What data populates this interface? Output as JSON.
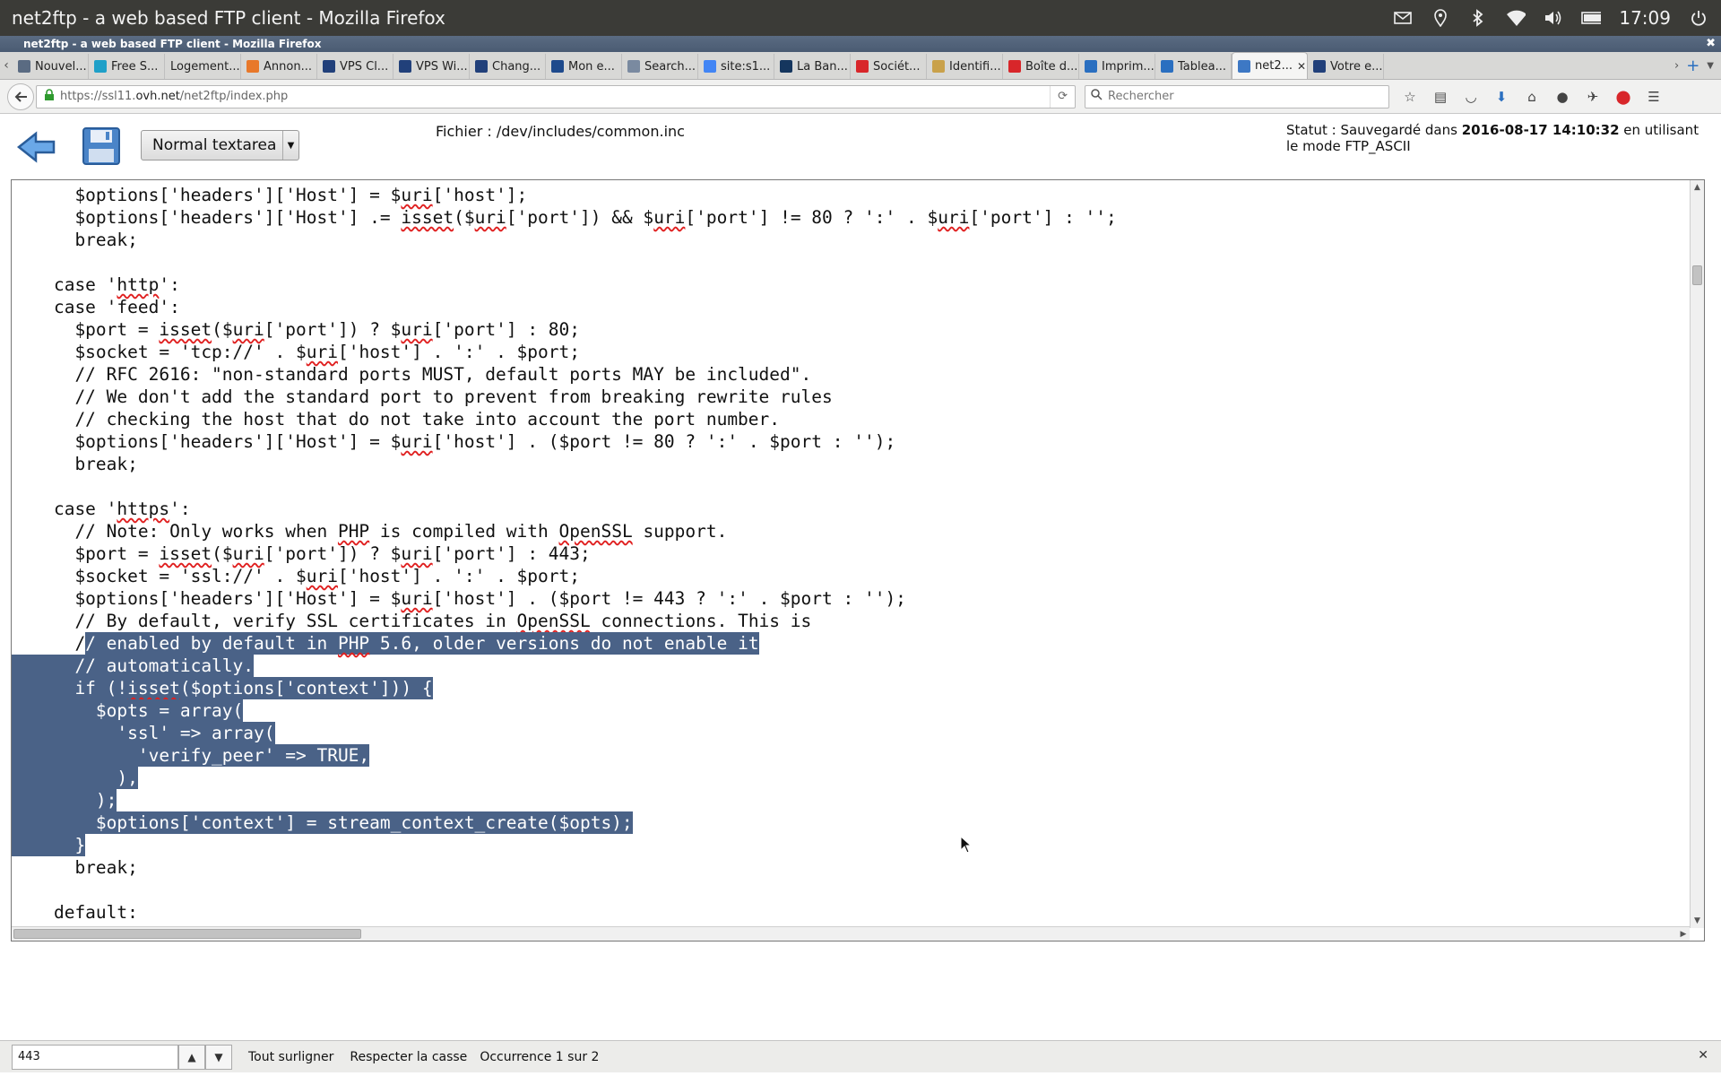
{
  "os": {
    "window_title": "net2ftp - a web based FTP client - Mozilla Firefox",
    "clock": "17:09"
  },
  "firefox": {
    "title_strip": "net2ftp - a web based FTP client - Mozilla Firefox",
    "tabs": [
      {
        "label": "Nouvel...",
        "icon": "pages-icon",
        "color": "#5a6b82"
      },
      {
        "label": "Free S...",
        "icon": "plus-icon",
        "color": "#1fa0c8"
      },
      {
        "label": "Logement...",
        "icon": "",
        "color": ""
      },
      {
        "label": "Annon...",
        "icon": "box-icon",
        "color": "#e8782a"
      },
      {
        "label": "VPS Cl...",
        "icon": "ovh-icon",
        "color": "#21407a"
      },
      {
        "label": "VPS Wi...",
        "icon": "ovh-icon",
        "color": "#21407a"
      },
      {
        "label": "Chang...",
        "icon": "ovh-icon",
        "color": "#21407a"
      },
      {
        "label": "Mon e...",
        "icon": "bank-icon",
        "color": "#1e4a8c"
      },
      {
        "label": "Search...",
        "icon": "search-engine-icon",
        "color": "#7a8aa0"
      },
      {
        "label": "site:s1...",
        "icon": "google-icon",
        "color": "#4285f4"
      },
      {
        "label": "La Ban...",
        "icon": "la-banque-icon",
        "color": "#15365e"
      },
      {
        "label": "Sociét...",
        "icon": "societe-icon",
        "color": "#d8262a"
      },
      {
        "label": "Identifi...",
        "icon": "id-icon",
        "color": "#c9a14a"
      },
      {
        "label": "Boîte d...",
        "icon": "gmail-icon",
        "color": "#d8262a"
      },
      {
        "label": "Imprim...",
        "icon": "print-icon",
        "color": "#2a6fc0"
      },
      {
        "label": "Tablea...",
        "icon": "ovh-icon",
        "color": "#2a6fc0"
      },
      {
        "label": "net2...",
        "icon": "net2ftp-icon",
        "color": "#3d78c4",
        "active": true
      },
      {
        "label": "Votre e...",
        "icon": "ovh-icon",
        "color": "#21407a"
      }
    ],
    "url_prefix": "https://ssl11.",
    "url_domain": "ovh.net",
    "url_path": "/net2ftp/index.php",
    "search_placeholder": "Rechercher"
  },
  "app": {
    "mode_label": "Normal textarea",
    "file_label": "Fichier : /dev/includes/common.inc",
    "status_prefix": "Statut : Sauvegardé dans ",
    "status_date": "2016-08-17 14:10:32",
    "status_suffix": " en utilisant le mode FTP_ASCII"
  },
  "code_lines": [
    {
      "text": "      $options['headers']['Host'] = $uri['host'];"
    },
    {
      "text": "      $options['headers']['Host'] .= isset($uri['port']) && $uri['port'] != 80 ? ':' . $uri['port'] : '';"
    },
    {
      "text": "      break;"
    },
    {
      "text": ""
    },
    {
      "text": "    case 'http':"
    },
    {
      "text": "    case 'feed':"
    },
    {
      "text": "      $port = isset($uri['port']) ? $uri['port'] : 80;"
    },
    {
      "text": "      $socket = 'tcp://' . $uri['host'] . ':' . $port;"
    },
    {
      "text": "      // RFC 2616: \"non-standard ports MUST, default ports MAY be included\"."
    },
    {
      "text": "      // We don't add the standard port to prevent from breaking rewrite rules"
    },
    {
      "text": "      // checking the host that do not take into account the port number."
    },
    {
      "text": "      $options['headers']['Host'] = $uri['host'] . ($port != 80 ? ':' . $port : '');"
    },
    {
      "text": "      break;"
    },
    {
      "text": ""
    },
    {
      "text": "    case 'https':"
    },
    {
      "text": "      // Note: Only works when PHP is compiled with OpenSSL support."
    },
    {
      "text": "      $port = isset($uri['port']) ? $uri['port'] : 443;"
    },
    {
      "text": "      $socket = 'ssl://' . $uri['host'] . ':' . $port;"
    },
    {
      "text": "      $options['headers']['Host'] = $uri['host'] . ($port != 443 ? ':' . $port : '');"
    },
    {
      "text": "      // By default, verify SSL certificates in OpenSSL connections. This is"
    },
    {
      "text": "      /",
      "sel": "/ enabled by default in PHP 5.6, older versions do not enable it"
    },
    {
      "text": "",
      "sel": "      // automatically."
    },
    {
      "text": "",
      "sel": "      if (!isset($options['context'])) {"
    },
    {
      "text": "",
      "sel": "        $opts = array("
    },
    {
      "text": "",
      "sel": "          'ssl' => array("
    },
    {
      "text": "",
      "sel": "            'verify_peer' => TRUE,"
    },
    {
      "text": "",
      "sel": "          ),"
    },
    {
      "text": "",
      "sel": "        );"
    },
    {
      "text": "",
      "sel": "        $options['context'] = stream_context_create($opts);"
    },
    {
      "text": "",
      "sel": "      }"
    },
    {
      "text": "      break;"
    },
    {
      "text": ""
    },
    {
      "text": "    default:"
    }
  ],
  "findbar": {
    "query": "443",
    "highlight_all": "Tout surligner",
    "match_case": "Respecter la casse",
    "occurrence": "Occurrence 1 sur 2"
  }
}
